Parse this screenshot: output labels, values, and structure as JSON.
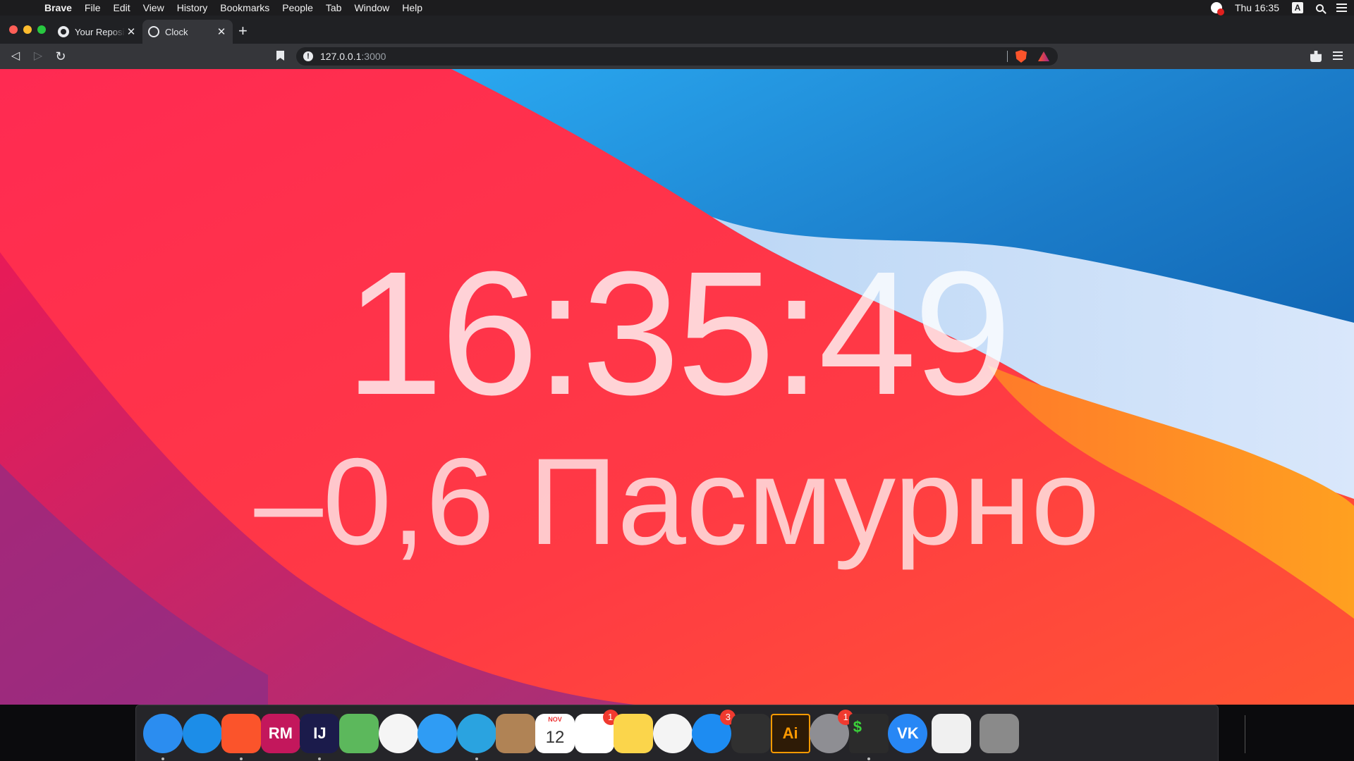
{
  "menubar": {
    "app_name": "Brave",
    "items": [
      "File",
      "Edit",
      "View",
      "History",
      "Bookmarks",
      "People",
      "Tab",
      "Window",
      "Help"
    ],
    "ime_letter": "A",
    "clock": "Thu 16:35"
  },
  "tabs": [
    {
      "title": "Your Reposit",
      "icon": "github-icon",
      "active": false
    },
    {
      "title": "Clock",
      "icon": "globe-icon",
      "active": true
    }
  ],
  "toolbar": {
    "url_host": "127.0.0.1",
    "url_port": ":3000"
  },
  "page": {
    "time": "16:35:49",
    "weather": "–0,6 Пасмурно"
  },
  "dock": {
    "items": [
      {
        "name": "finder",
        "label": "",
        "color": "#2b8df0",
        "running": true
      },
      {
        "name": "safari",
        "label": "",
        "color": "#1c8de8",
        "running": false
      },
      {
        "name": "brave",
        "label": "",
        "color": "#fb542b",
        "running": true
      },
      {
        "name": "rubymine",
        "label": "RM",
        "color": "#c3175c",
        "running": false
      },
      {
        "name": "intellij-idea",
        "label": "IJ",
        "color": "#1b1b4b",
        "running": true
      },
      {
        "name": "maps",
        "label": "",
        "color": "#5cb85c",
        "running": false
      },
      {
        "name": "photos",
        "label": "",
        "color": "#f5f5f5",
        "running": false
      },
      {
        "name": "messages",
        "label": "",
        "color": "#2f9cf4",
        "running": false
      },
      {
        "name": "telegram",
        "label": "",
        "color": "#2aa3e0",
        "running": true
      },
      {
        "name": "contacts",
        "label": "",
        "color": "#b08355",
        "running": false
      },
      {
        "name": "calendar",
        "label": "12",
        "month": "NOV",
        "color": "#ffffff",
        "running": false
      },
      {
        "name": "reminders",
        "label": "",
        "color": "#ffffff",
        "running": false,
        "badge": "1"
      },
      {
        "name": "notes",
        "label": "",
        "color": "#fbd54b",
        "running": false
      },
      {
        "name": "itunes",
        "label": "",
        "color": "#f4f4f4",
        "running": false
      },
      {
        "name": "app-store",
        "label": "",
        "color": "#1d8cf2",
        "running": false,
        "badge": "3"
      },
      {
        "name": "final-cut-pro",
        "label": "",
        "color": "#303030",
        "running": false
      },
      {
        "name": "illustrator",
        "label": "Ai",
        "color": "#2e1b06",
        "running": false
      },
      {
        "name": "system-preferences",
        "label": "",
        "color": "#8e8e93",
        "running": false,
        "badge": "1"
      },
      {
        "name": "terminal",
        "label": "$",
        "color": "#2b2b2b",
        "running": true
      },
      {
        "name": "vk",
        "label": "VK",
        "color": "#2787f5",
        "running": false
      },
      {
        "name": "activity-monitor",
        "label": "",
        "color": "#f0f0f0",
        "running": false
      },
      {
        "name": "trash",
        "label": "",
        "color": "#8a8a8a",
        "running": false
      }
    ]
  }
}
